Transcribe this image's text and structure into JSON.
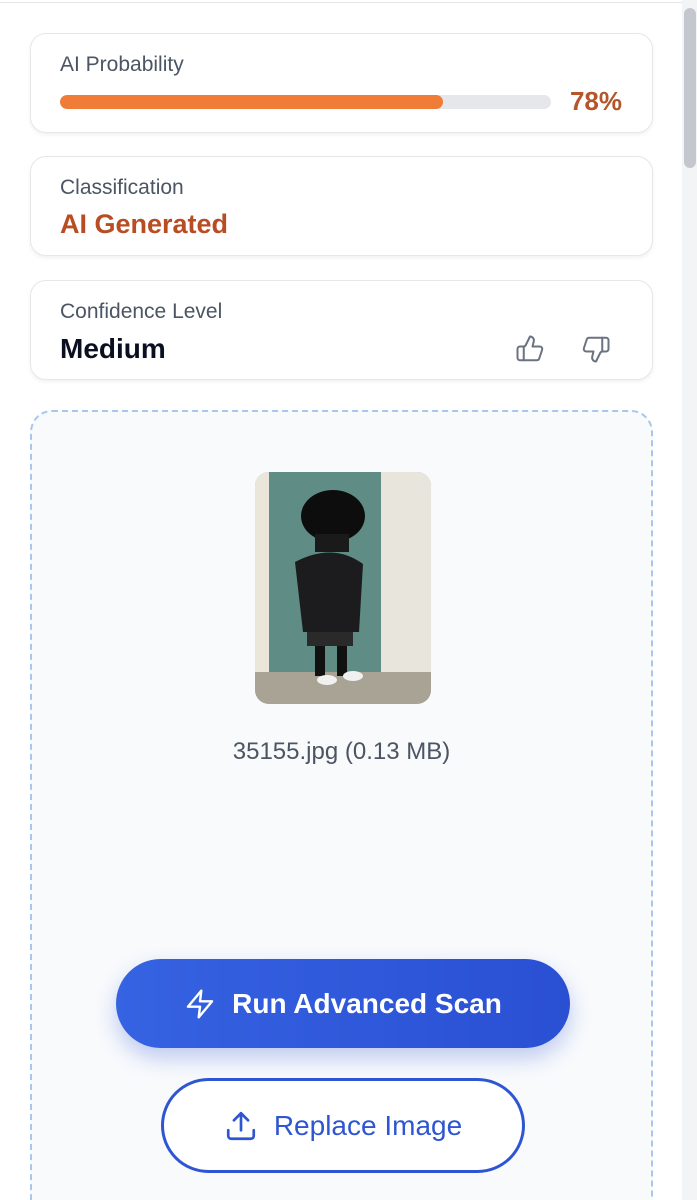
{
  "probability": {
    "label": "AI Probability",
    "value_text": "78%",
    "value": 0.78,
    "bar_color": "#ef7d37",
    "value_color": "#b4552a"
  },
  "classification": {
    "label": "Classification",
    "value": "AI Generated",
    "value_color": "#b84c22"
  },
  "confidence": {
    "label": "Confidence Level",
    "value": "Medium",
    "thumbs_up_icon": "thumbs-up-icon",
    "thumbs_down_icon": "thumbs-down-icon"
  },
  "upload": {
    "file_info": "35155.jpg (0.13 MB)"
  },
  "actions": {
    "scan_label": "Run Advanced Scan",
    "scan_icon": "lightning-icon",
    "replace_label": "Replace Image",
    "replace_icon": "upload-icon"
  }
}
